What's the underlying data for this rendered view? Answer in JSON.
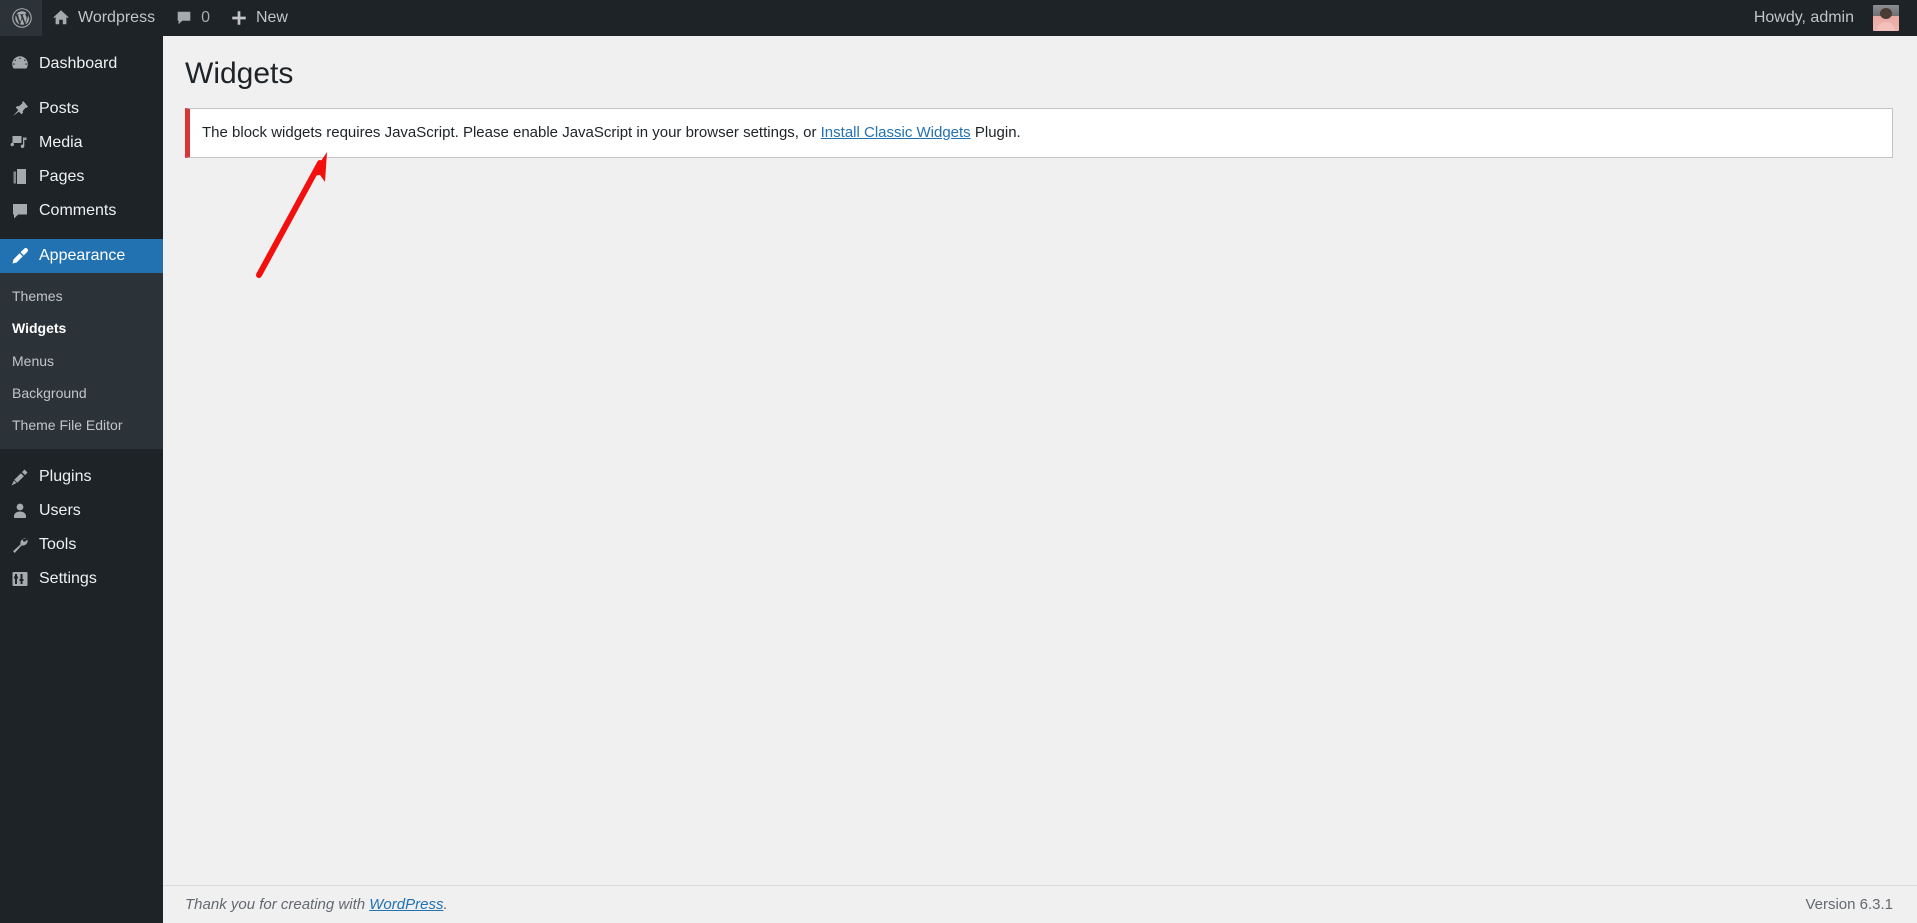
{
  "adminbar": {
    "logo_icon": "wordpress-logo-icon",
    "site_name": "Wordpress",
    "site_icon": "home-icon",
    "comments_icon": "comment-bubble-icon",
    "comments_count": "0",
    "new_icon": "plus-icon",
    "new_label": "New",
    "howdy": "Howdy, admin",
    "avatar": "user-avatar"
  },
  "sidebar": {
    "items": [
      {
        "label": "Dashboard",
        "icon": "dashboard-icon",
        "current": false
      },
      {
        "label": "Posts",
        "icon": "pin-icon",
        "current": false
      },
      {
        "label": "Media",
        "icon": "media-icon",
        "current": false
      },
      {
        "label": "Pages",
        "icon": "pages-icon",
        "current": false
      },
      {
        "label": "Comments",
        "icon": "comment-bubble-icon",
        "current": false
      },
      {
        "label": "Appearance",
        "icon": "paintbrush-icon",
        "current": true
      },
      {
        "label": "Plugins",
        "icon": "plug-icon",
        "current": false
      },
      {
        "label": "Users",
        "icon": "user-icon",
        "current": false
      },
      {
        "label": "Tools",
        "icon": "wrench-icon",
        "current": false
      },
      {
        "label": "Settings",
        "icon": "sliders-icon",
        "current": false
      }
    ],
    "submenu": [
      {
        "label": "Themes",
        "current": false
      },
      {
        "label": "Widgets",
        "current": true
      },
      {
        "label": "Menus",
        "current": false
      },
      {
        "label": "Background",
        "current": false
      },
      {
        "label": "Theme File Editor",
        "current": false
      }
    ]
  },
  "main": {
    "page_title": "Widgets",
    "notice": {
      "text_before": "The block widgets requires JavaScript. Please enable JavaScript in your browser settings, or ",
      "link_label": "Install Classic Widgets",
      "text_after": " Plugin.",
      "accent_color": "#d63638"
    }
  },
  "footer": {
    "thanks_before": "Thank you for creating with ",
    "thanks_link": "WordPress",
    "thanks_after": ".",
    "version": "Version 6.3.1"
  },
  "annotation": {
    "arrow_color": "#f40f0f",
    "arrow_name": "red-arrow-pointing-to-notice"
  }
}
